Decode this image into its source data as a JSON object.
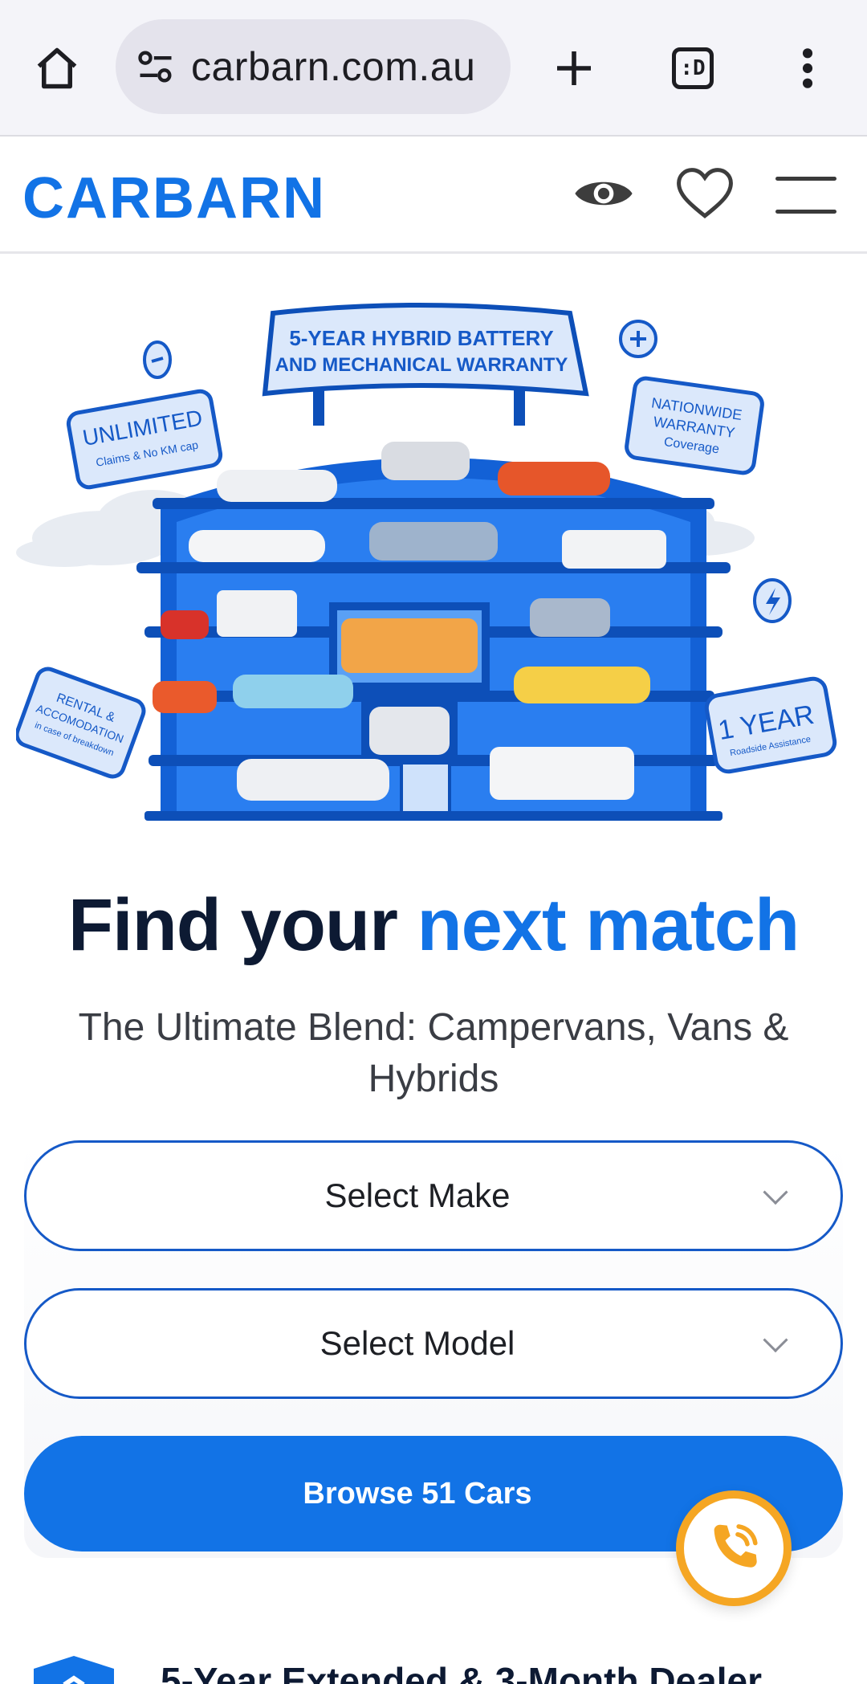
{
  "browser": {
    "url": "carbarn.com.au",
    "tab_count_label": ":D"
  },
  "header": {
    "logo": "CARBARN"
  },
  "hero": {
    "banner_line1": "5-YEAR HYBRID BATTERY",
    "banner_line2": "AND MECHANICAL WARRANTY",
    "badge_unlimited_title": "UNLIMITED",
    "badge_unlimited_sub": "Claims & No KM cap",
    "badge_nationwide_line1": "NATIONWIDE",
    "badge_nationwide_line2": "WARRANTY",
    "badge_nationwide_line3": "Coverage",
    "badge_rental_line1": "RENTAL &",
    "badge_rental_line2": "ACCOMODATION",
    "badge_rental_line3": "in case of breakdown",
    "badge_year_title": "1 YEAR",
    "badge_year_sub": "Roadside Assistance"
  },
  "main": {
    "headline_part1": "Find your ",
    "headline_part2": "next match",
    "subheadline": "The Ultimate Blend: Campervans, Vans & Hybrids"
  },
  "search": {
    "make_label": "Select Make",
    "model_label": "Select Model",
    "browse_label": "Browse 51 Cars"
  },
  "teaser": {
    "text": "5-Year Extended & 3-Month Dealer"
  },
  "colors": {
    "brand_blue": "#1273e6",
    "call_orange": "#f5a623"
  }
}
